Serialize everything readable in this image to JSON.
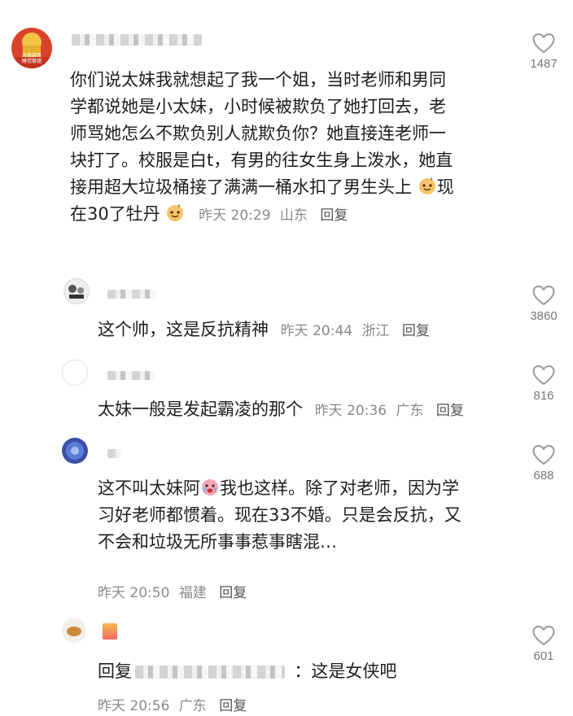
{
  "comments": [
    {
      "text_lines": [
        "你们说太妹我就想起了我一个姐，当时老师和男同",
        "学都说她是小太妹，小时候被欺负了她打回去，老",
        "师骂她怎么不欺负别人就欺负你？她直接连老师一",
        "块打了。校服是白t，有男的往女生身上泼水，她直",
        "接用超大垃圾桶接了满满一桶水扣了男生头上"
      ],
      "last_line_mid": "现",
      "last_line_2": "在30了牡丹",
      "time": "昨天 20:29",
      "location": "山东",
      "reply": "回复",
      "likes": "1487",
      "avatar_text_1": "苏高森哥",
      "avatar_text_2": "睡觉瓣翘"
    },
    {
      "text": "这个帅，这是反抗精神",
      "time": "昨天 20:44",
      "location": "浙江",
      "reply": "回复",
      "likes": "3860"
    },
    {
      "text": "太妹一般是发起霸凌的那个",
      "time": "昨天 20:36",
      "location": "广东",
      "reply": "回复",
      "likes": "816"
    },
    {
      "text_a": "这不叫太妹阿",
      "text_b": "我也这样。除了对老师，因为学",
      "text_lines": [
        "习好老师都惯着。现在33不婚。只是会反抗，又",
        "不会和垃圾无所事事惹事瞎混…"
      ],
      "time": "昨天 20:50",
      "location": "福建",
      "reply": "回复",
      "likes": "688"
    },
    {
      "text_prefix": "回复",
      "text_suffix": "：这是女侠吧",
      "time": "昨天 20:56",
      "location": "广东",
      "reply": "回复",
      "likes": "601"
    }
  ],
  "colors": {
    "meta": "#8a8a8a",
    "text": "#1e1e1e",
    "heart": "#9a9a9a"
  },
  "icons": [
    "heart-outline-icon",
    "smile-dog-emoji",
    "crying-face-emoji"
  ]
}
